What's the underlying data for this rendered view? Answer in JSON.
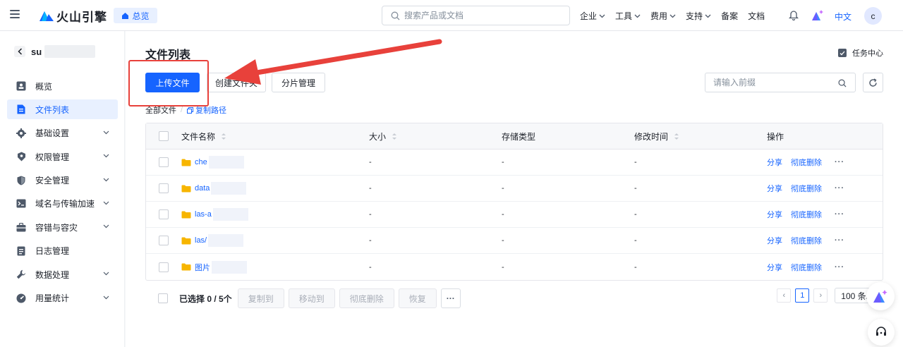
{
  "brand": {
    "name": "火山引擎",
    "home_tab": "总览",
    "logo_color": "#1664ff"
  },
  "search": {
    "placeholder": "搜索产品或文档"
  },
  "topnav": [
    {
      "label": "企业",
      "has_menu": true
    },
    {
      "label": "工具",
      "has_menu": true
    },
    {
      "label": "费用",
      "has_menu": true
    },
    {
      "label": "支持",
      "has_menu": true
    },
    {
      "label": "备案",
      "has_menu": false
    },
    {
      "label": "文档",
      "has_menu": false
    }
  ],
  "lang": "中文",
  "user_initial": "c",
  "sidebar": {
    "bucket_name": "su",
    "items": [
      {
        "label": "概览",
        "icon": "dashboard-icon",
        "expandable": false,
        "active": false
      },
      {
        "label": "文件列表",
        "icon": "file-icon",
        "expandable": false,
        "active": true
      },
      {
        "label": "基础设置",
        "icon": "gear-icon",
        "expandable": true,
        "active": false
      },
      {
        "label": "权限管理",
        "icon": "key-icon",
        "expandable": true,
        "active": false
      },
      {
        "label": "安全管理",
        "icon": "shield-icon",
        "expandable": true,
        "active": false
      },
      {
        "label": "域名与传输加速",
        "icon": "terminal-icon",
        "expandable": true,
        "active": false
      },
      {
        "label": "容错与容灾",
        "icon": "toolbox-icon",
        "expandable": true,
        "active": false
      },
      {
        "label": "日志管理",
        "icon": "log-icon",
        "expandable": false,
        "active": false
      },
      {
        "label": "数据处理",
        "icon": "wrench-icon",
        "expandable": true,
        "active": false
      },
      {
        "label": "用量统计",
        "icon": "gauge-icon",
        "expandable": true,
        "active": false
      }
    ]
  },
  "main": {
    "title": "文件列表",
    "task_center": "任务中心",
    "upload_label": "上传文件",
    "create_folder_label": "创建文件夹",
    "multipart_label": "分片管理",
    "prefix_placeholder": "请输入前缀",
    "breadcrumb_root": "全部文件",
    "copy_path_label": "复制路径",
    "columns": [
      "文件名称",
      "大小",
      "存储类型",
      "修改时间",
      "操作"
    ],
    "rows": [
      {
        "name": "che",
        "size": "-",
        "type": "-",
        "time": "-"
      },
      {
        "name": "data",
        "size": "-",
        "type": "-",
        "time": "-"
      },
      {
        "name": "las-a",
        "size": "-",
        "type": "-",
        "time": "-"
      },
      {
        "name": "las/",
        "size": "-",
        "type": "-",
        "time": "-"
      },
      {
        "name": "图片",
        "size": "-",
        "type": "-",
        "time": "-"
      }
    ],
    "row_actions": {
      "share": "分享",
      "delete": "彻底删除",
      "more": "···"
    },
    "footer": {
      "selected": "已选择 0 / 5个",
      "copy_to": "复制到",
      "move_to": "移动到",
      "delete": "彻底删除",
      "restore": "恢复",
      "more": "···",
      "page_prev": "‹",
      "page_current": "1",
      "page_next": "›",
      "page_size": "100 条/页"
    }
  },
  "annotation": {
    "color": "#e8413b"
  }
}
